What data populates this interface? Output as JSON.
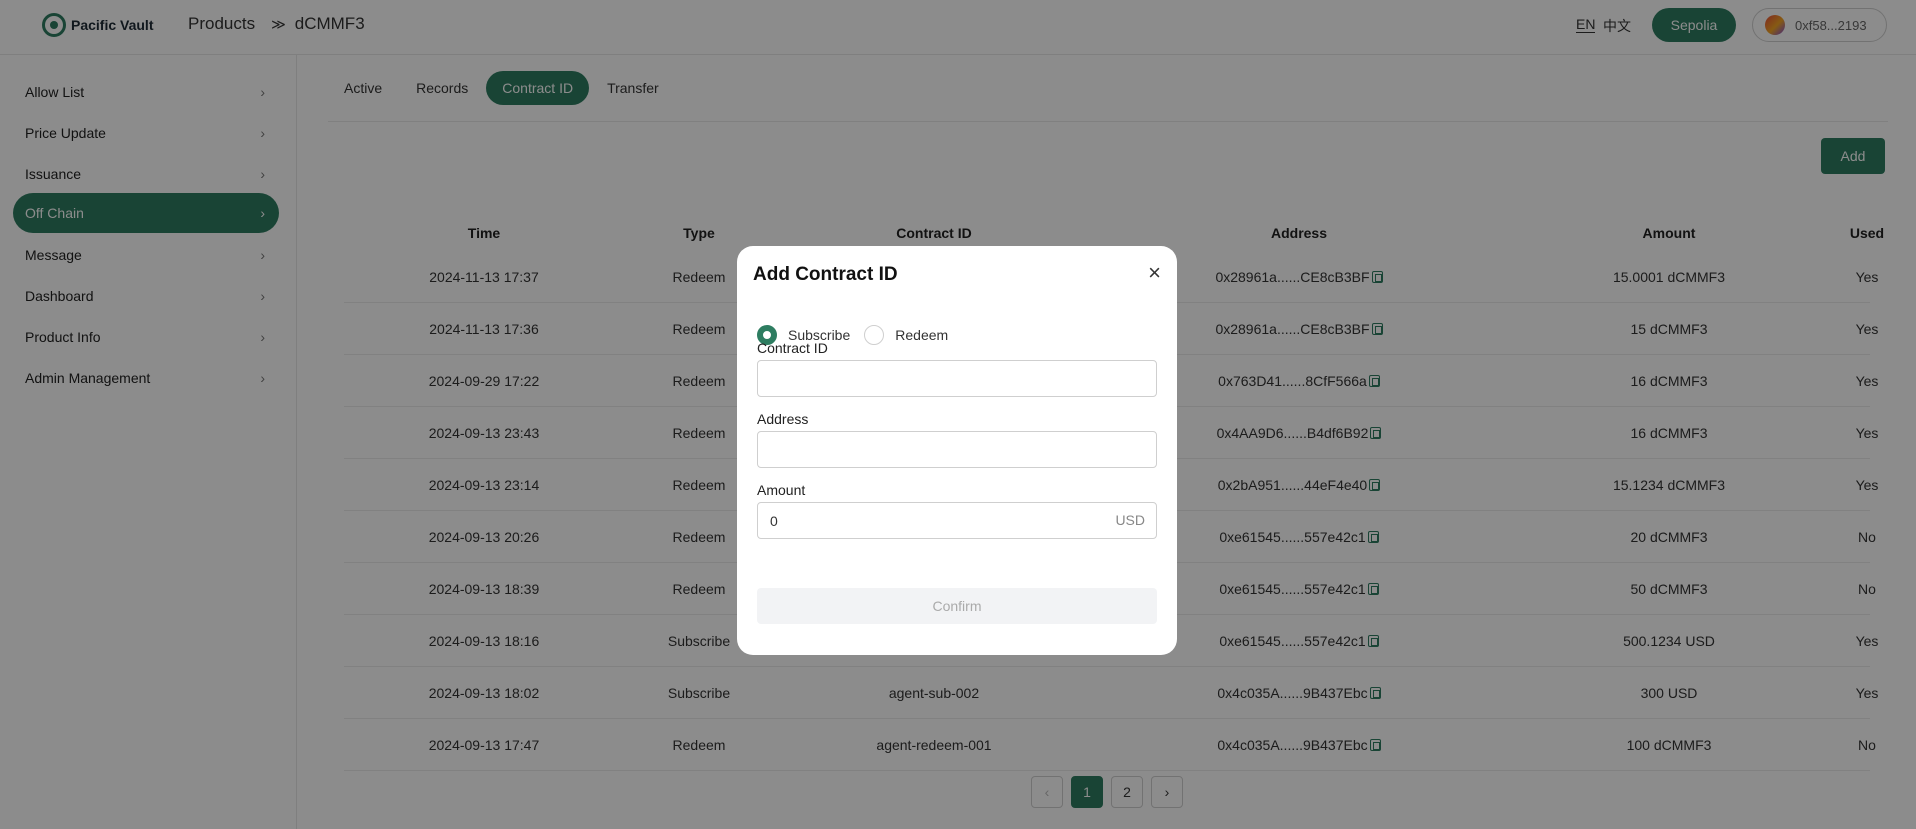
{
  "header": {
    "brand": "Pacific Vault",
    "breadcrumb": [
      "Products",
      "dCMMF3"
    ],
    "breadcrumb_separator": "≫",
    "lang_en": "EN",
    "lang_zh": "中文",
    "network": "Sepolia",
    "wallet": "0xf58...2193"
  },
  "sidebar": {
    "items": [
      {
        "label": "Allow List"
      },
      {
        "label": "Price Update"
      },
      {
        "label": "Issuance"
      },
      {
        "label": "Off Chain",
        "active": true
      },
      {
        "label": "Message"
      },
      {
        "label": "Dashboard"
      },
      {
        "label": "Product Info"
      },
      {
        "label": "Admin Management"
      }
    ]
  },
  "tabs": [
    {
      "label": "Active"
    },
    {
      "label": "Records"
    },
    {
      "label": "Contract ID",
      "active": true
    },
    {
      "label": "Transfer"
    }
  ],
  "toolbar": {
    "add_label": "Add"
  },
  "table": {
    "columns": [
      "Time",
      "Type",
      "Contract ID",
      "Address",
      "Amount",
      "Used"
    ],
    "rows": [
      {
        "time": "2024-11-13 17:37",
        "type": "Redeem",
        "contract_id": "",
        "address": "0x28961a......CE8cB3BF",
        "amount": "15.0001 dCMMF3",
        "used": "Yes"
      },
      {
        "time": "2024-11-13 17:36",
        "type": "Redeem",
        "contract_id": "",
        "address": "0x28961a......CE8cB3BF",
        "amount": "15 dCMMF3",
        "used": "Yes"
      },
      {
        "time": "2024-09-29 17:22",
        "type": "Redeem",
        "contract_id": "",
        "address": "0x763D41......8CfF566a",
        "amount": "16 dCMMF3",
        "used": "Yes"
      },
      {
        "time": "2024-09-13 23:43",
        "type": "Redeem",
        "contract_id": "",
        "address": "0x4AA9D6......B4df6B92",
        "amount": "16 dCMMF3",
        "used": "Yes"
      },
      {
        "time": "2024-09-13 23:14",
        "type": "Redeem",
        "contract_id": "",
        "address": "0x2bA951......44eF4e40",
        "amount": "15.1234 dCMMF3",
        "used": "Yes"
      },
      {
        "time": "2024-09-13 20:26",
        "type": "Redeem",
        "contract_id": "",
        "address": "0xe61545......557e42c1",
        "amount": "20 dCMMF3",
        "used": "No"
      },
      {
        "time": "2024-09-13 18:39",
        "type": "Redeem",
        "contract_id": "",
        "address": "0xe61545......557e42c1",
        "amount": "50 dCMMF3",
        "used": "No"
      },
      {
        "time": "2024-09-13 18:16",
        "type": "Subscribe",
        "contract_id": "",
        "address": "0xe61545......557e42c1",
        "amount": "500.1234 USD",
        "used": "Yes"
      },
      {
        "time": "2024-09-13 18:02",
        "type": "Subscribe",
        "contract_id": "agent-sub-002",
        "address": "0x4c035A......9B437Ebc",
        "amount": "300 USD",
        "used": "Yes"
      },
      {
        "time": "2024-09-13 17:47",
        "type": "Redeem",
        "contract_id": "agent-redeem-001",
        "address": "0x4c035A......9B437Ebc",
        "amount": "100 dCMMF3",
        "used": "No"
      }
    ]
  },
  "pagination": {
    "prev": "‹",
    "next": "›",
    "pages": [
      "1",
      "2"
    ],
    "current": "1"
  },
  "modal": {
    "title": "Add Contract ID",
    "close": "×",
    "radio_subscribe": "Subscribe",
    "radio_redeem": "Redeem",
    "selected": "Subscribe",
    "contract_id_label": "Contract ID",
    "contract_id_value": "",
    "address_label": "Address",
    "address_value": "",
    "amount_label": "Amount",
    "amount_value": "0",
    "amount_suffix": "USD",
    "confirm_label": "Confirm"
  },
  "colors": {
    "accent": "#2e7d61",
    "overlay": "rgba(0,0,0,0.45)"
  }
}
